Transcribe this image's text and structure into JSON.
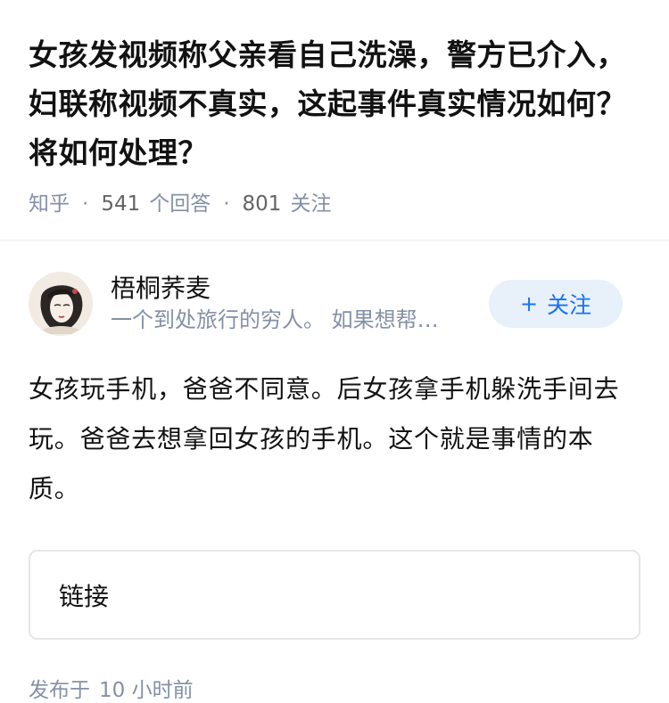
{
  "question": {
    "title": "女孩发视频称父亲看自己洗澡，警方已介入，妇联称视频不真实，这起事件真实情况如何？将如何处理？",
    "source": "知乎",
    "separator": "·",
    "answers_count": "541",
    "answers_label": "个回答",
    "follows_count": "801",
    "follows_label": "关注"
  },
  "answer": {
    "author": {
      "name": "梧桐荞麦",
      "bio": "一个到处旅行的穷人。 如果想帮…",
      "avatar_icon": "avatar-portrait-icon"
    },
    "follow_button": {
      "icon": "+",
      "label": "关注"
    },
    "content": "女孩玩手机，爸爸不同意。后女孩拿手机躲洗手间去玩。爸爸去想拿回女孩的手机。这个就是事情的本质。",
    "link_card": {
      "label": "链接"
    },
    "publish": {
      "prefix": "发布于",
      "time": "10 小时前"
    }
  },
  "colors": {
    "text": "#121212",
    "meta": "#8590a6",
    "accent": "#1772f6",
    "follow_bg": "#e8f0fa",
    "border": "#e6e6e6"
  }
}
